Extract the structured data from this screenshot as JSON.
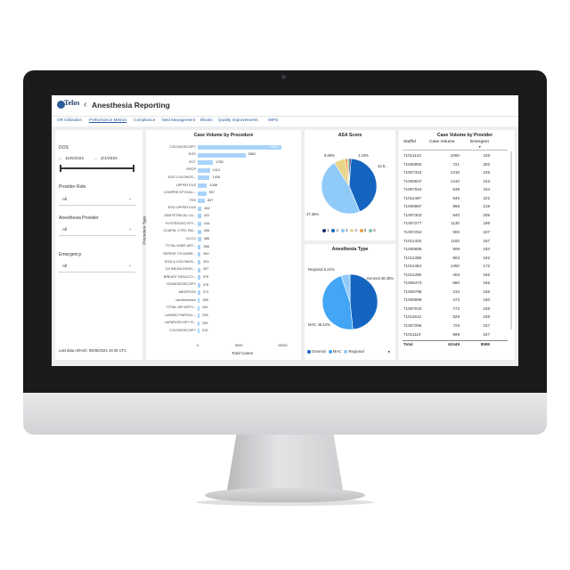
{
  "app": {
    "logo_text": "Telos",
    "title": "Anesthesia Reporting"
  },
  "tabs": [
    "OR Utilization",
    "Performance Metrics",
    "Compliance",
    "Med Management",
    "Blocks",
    "Quality Improvements",
    "MIPS"
  ],
  "active_tab": "Performance Metrics",
  "filters": {
    "dos_label": "DOS",
    "date_start": "11/6/2022",
    "date_end": "2/1/2024",
    "provider_role_label": "Provider Role",
    "provider_role_value": "All",
    "anesthesia_provider_label": "Anesthesia Provider",
    "anesthesia_provider_value": "All",
    "emergency_label": "Emergency",
    "emergency_value": "All",
    "refresh": "Last data refresh: 05/06/2024 19:28 UTC"
  },
  "colors": {
    "accent": "#2a5aa3",
    "bar": "#a9d3fb",
    "dark_blue": "#1565c0",
    "light_blue": "#90caf9"
  },
  "chart_data": [
    {
      "type": "bar",
      "title": "Case Volume by Procedure",
      "xlabel": "Total Cases",
      "ylabel": "Procedure Type",
      "xlim": [
        0,
        10000
      ],
      "xticks": [
        "0",
        "5000",
        "10000"
      ],
      "categories": [
        "COLONOSCOPY",
        "EGD",
        "ECT",
        "ERCP",
        "EGD COLONOS...",
        "UPPER EUS",
        "COMPRE EP EVAL...",
        "TEE",
        "EGD UPPER EUS",
        "OBSTETRICAL CA...",
        "HYSTEROSCOPY...",
        "XCAPSL CTRC RM...",
        "DCCV",
        "TOTAL KNEE ART...",
        "REPEAT CS MORE...",
        "EGD & COLONOS...",
        "DX BRONCHOSC...",
        "BREAST REDUCTI...",
        "SIGMOIDOSCOPY",
        "ABORTION",
        "cardioversion",
        "TOTAL HIP ARTH...",
        "LAPARO PARTIAL...",
        "LAPAROSCOPY R...",
        "COLONOSCOPY"
      ],
      "values": [
        9801,
        5582,
        1785,
        1412,
        1406,
        1088,
        997,
        837,
        462,
        422,
        416,
        406,
        385,
        358,
        340,
        323,
        297,
        279,
        275,
        274,
        255,
        241,
        233,
        229,
        212
      ],
      "value_labels": [
        "9801",
        "5582",
        "1785",
        "1412",
        "1406",
        "1088",
        "997",
        "837",
        "462",
        "422",
        "416",
        "406",
        "385",
        "358",
        "340",
        "323",
        "297",
        "279",
        "275",
        "274",
        "255",
        "241",
        "233",
        "229",
        "212"
      ]
    },
    {
      "type": "pie",
      "title": "ASA Score",
      "categories": [
        "1",
        "2",
        "3",
        "4",
        "5",
        "6"
      ],
      "values": [
        1.19,
        42.5,
        47.36,
        6.59,
        1.5,
        0.86
      ],
      "labels": [
        "1.19%",
        "42.5...",
        "47.36%",
        "6.59%"
      ],
      "colors": [
        "#1b2f6b",
        "#1565c0",
        "#90caf9",
        "#e8d589",
        "#f0a04b",
        "#7cc3a0"
      ]
    },
    {
      "type": "pie",
      "title": "Anesthesia Type",
      "categories": [
        "General",
        "MAC",
        "Regional"
      ],
      "values": [
        48.35,
        46.43,
        5.22
      ],
      "labels": [
        "General 48.35%",
        "MAC 46.43%",
        "Regional 5.22%"
      ],
      "colors": [
        "#1565c0",
        "#42a5f5",
        "#90caf9"
      ]
    }
  ],
  "provider_table": {
    "title": "Case Volume by Provider",
    "columns": [
      "StaffId",
      "Case Volume",
      "Emergent"
    ],
    "rows": [
      [
        "71011143",
        "1060",
        "349"
      ],
      [
        "71006992",
        "721",
        "262"
      ],
      [
        "71007323",
        "1218",
        "245"
      ],
      [
        "71006947",
        "1410",
        "243"
      ],
      [
        "71007024",
        "539",
        "234"
      ],
      [
        "71011487",
        "945",
        "222"
      ],
      [
        "71006987",
        "968",
        "219"
      ],
      [
        "71007303",
        "940",
        "205"
      ],
      [
        "71007277",
        "1130",
        "196"
      ],
      [
        "71007254",
        "600",
        "187"
      ],
      [
        "71011403",
        "1152",
        "187"
      ],
      [
        "71006586",
        "908",
        "184"
      ],
      [
        "71011389",
        "803",
        "182"
      ],
      [
        "71011484",
        "1492",
        "172"
      ],
      [
        "71011395",
        "403",
        "166"
      ],
      [
        "71005473",
        "680",
        "165"
      ],
      [
        "71006788",
        "310",
        "165"
      ],
      [
        "71006998",
        "472",
        "160"
      ],
      [
        "71007043",
        "772",
        "158"
      ],
      [
        "71011512",
        "528",
        "158"
      ],
      [
        "71007256",
        "723",
        "157"
      ],
      [
        "71011110",
        "899",
        "157"
      ]
    ],
    "total": [
      "Total",
      "62449",
      "8599"
    ]
  }
}
